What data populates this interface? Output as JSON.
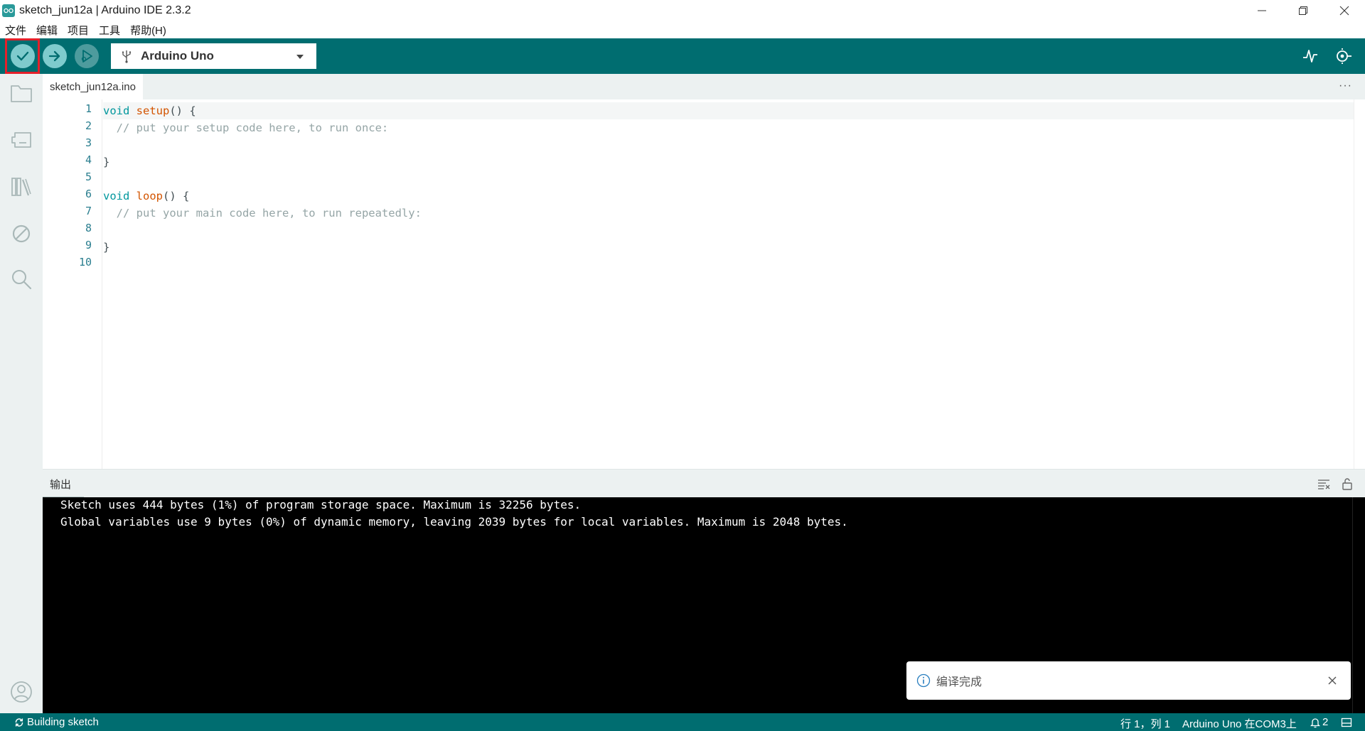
{
  "window": {
    "title": "sketch_jun12a | Arduino IDE 2.3.2"
  },
  "menu": {
    "items": [
      "文件",
      "编辑",
      "项目",
      "工具",
      "帮助(H)"
    ]
  },
  "toolbar": {
    "board": "Arduino Uno"
  },
  "editor": {
    "tab": "sketch_jun12a.ino",
    "line_numbers": [
      "1",
      "2",
      "3",
      "4",
      "5",
      "6",
      "7",
      "8",
      "9",
      "10"
    ],
    "lines": [
      {
        "kw": "void ",
        "fn": "setup",
        "rest": "() {"
      },
      {
        "comment": "  // put your setup code here, to run once:"
      },
      {
        "text": ""
      },
      {
        "text": "}"
      },
      {
        "text": ""
      },
      {
        "kw": "void ",
        "fn": "loop",
        "rest": "() {"
      },
      {
        "comment": "  // put your main code here, to run repeatedly:"
      },
      {
        "text": ""
      },
      {
        "text": "}"
      },
      {
        "text": ""
      }
    ]
  },
  "output": {
    "title": "输出",
    "lines": [
      "Sketch uses 444 bytes (1%) of program storage space. Maximum is 32256 bytes.",
      "Global variables use 9 bytes (0%) of dynamic memory, leaving 2039 bytes for local variables. Maximum is 2048 bytes."
    ]
  },
  "notification": {
    "text": "编译完成"
  },
  "status": {
    "task": "Building sketch",
    "position": "行 1，列 1",
    "board_port": "Arduino Uno 在COM3上",
    "notifications_count": "2"
  },
  "colors": {
    "teal": "#006d70",
    "verify_highlight": "#e4202a"
  }
}
